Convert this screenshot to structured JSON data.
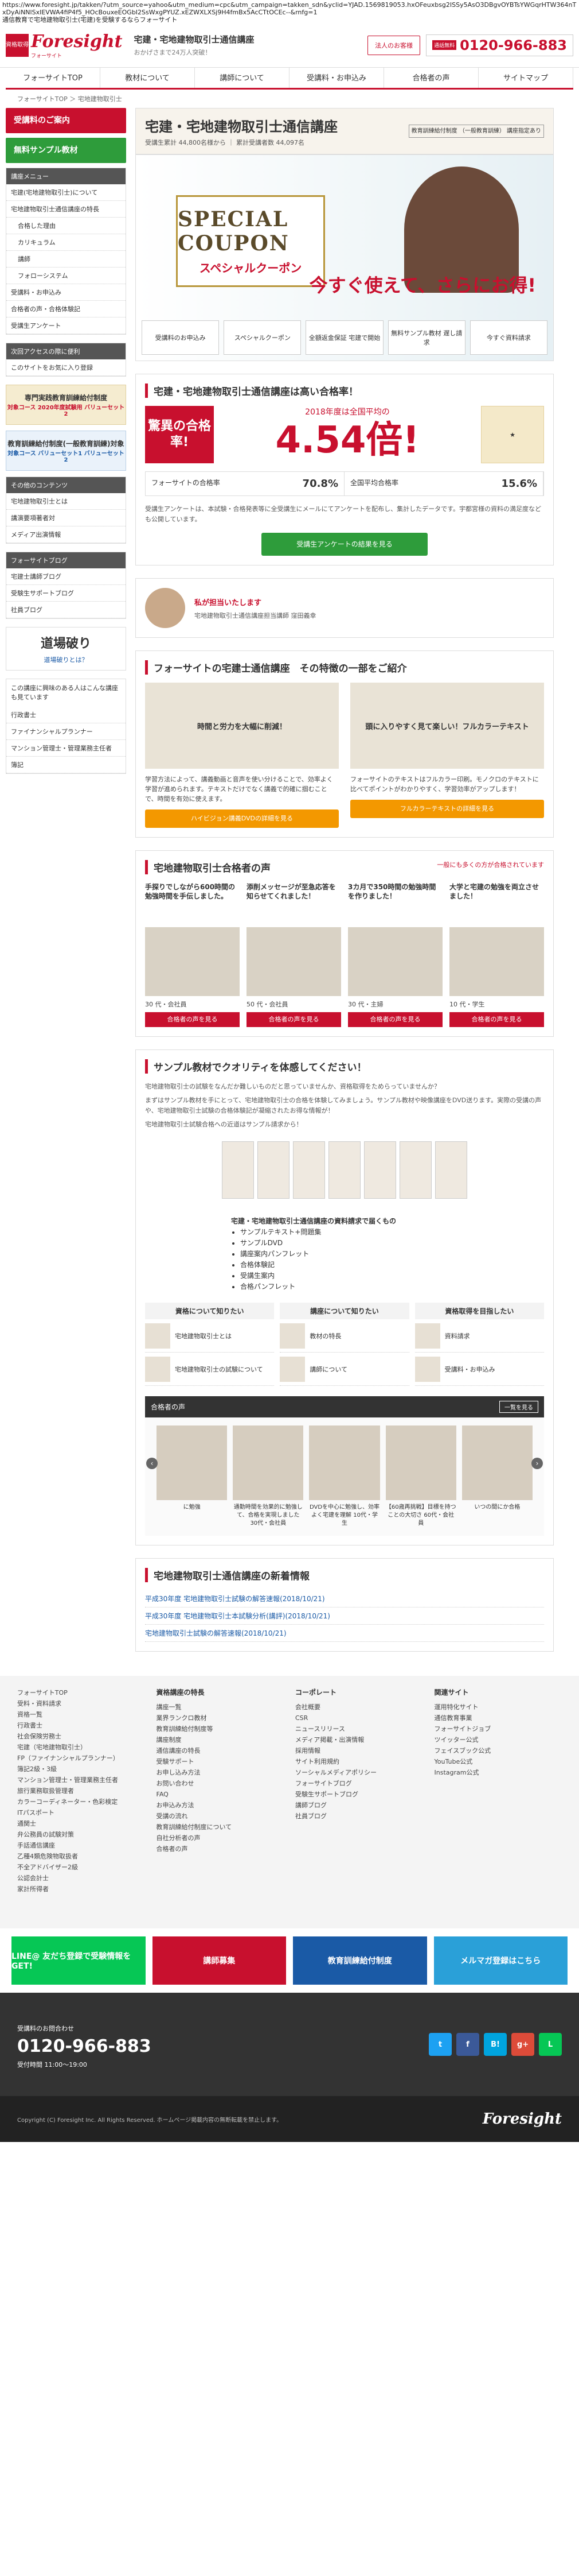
{
  "browser": {
    "url": "https://www.foresight.jp/takken/?utm_source=yahoo&utm_medium=cpc&utm_campaign=takken_sdn&yclid=YJAD.1569819053.hxOFeuxbsg2ISSy5AsO3DBgvOYBTsYWGqrHTW364nTxDyAiNNlSxIEVWA4fiP4f5_HOcBouxeEOGbI2SsWxgPYUZ.xEZWXLXSj9H4fmBx5AcCTtOCEc--&rnfg=1",
    "tab_title": "通信教育で宅地建物取引士(宅建)を受験するならフォーサイト"
  },
  "header": {
    "logo_badge": "資格取得",
    "logo_name": "Foresight",
    "logo_kana": "フォーサイト",
    "title": "宅建・宅地建物取引士通信講座",
    "subtitle": "おかげさまで24万人突破！",
    "corp_button": "法人のお客様",
    "free_badge": "通話無料",
    "tel": "0120-966-883"
  },
  "nav": [
    "フォーサイトTOP",
    "教材について",
    "講師について",
    "受講料・お申込み",
    "合格者の声",
    "サイトマップ"
  ],
  "breadcrumb": "フォーサイトTOP ＞ 宅地建物取引士",
  "sidebar": {
    "apply": "受講料のご案内",
    "sample": "無料サンプル教材",
    "menu_title": "講座メニュー",
    "menu": [
      "宅建(宅地建物取引士)について",
      "宅地建物取引士通信講座の特長",
      "合格した理由",
      "カリキュラム",
      "講師",
      "フォローシステム",
      "受講料・お申込み",
      "合格者の声・合格体験記",
      "受講生アンケート"
    ],
    "sub_idx": [
      2,
      3,
      4,
      5
    ],
    "access_title": "次回アクセスの際に便利",
    "bookmark": "このサイトをお気に入り登録",
    "ban1": "専門実践教育訓練給付制度",
    "ban1_sub": "対象コース 2020年度試験用 バリューセット2",
    "ban2": "教育訓練給付制度(一般教育訓練)対象",
    "ban2_sub": "対象コース バリューセット1 バリューセット2",
    "other_title": "その他のコンテンツ",
    "other": [
      "宅地建物取引士とは",
      "講演要項著者対",
      "メディア出演情報"
    ],
    "blog_title": "フォーサイトブログ",
    "blog": [
      "宅建士講師ブログ",
      "受験生サポートブログ",
      "社員ブログ"
    ],
    "dojo": "道場破り",
    "dojo_link": "道場破りとは？",
    "also_title": "この講座に興味のある人はこんな講座も見ています",
    "also": [
      "行政書士",
      "ファイナンシャルプランナー",
      "マンション管理士・管理業務主任者",
      "簿記"
    ]
  },
  "product": {
    "title": "宅建・宅地建物取引士通信講座",
    "meta": "受講生累計 44,800名様から ｜ 累計受講者数 44,097名",
    "tag": "教育訓練給付制度 （一般教育訓練） 講座指定あり"
  },
  "coupon": {
    "en": "SPECIAL COUPON",
    "kana": "スペシャルクーポン",
    "copy": "今すぐ使えて、さらにお得!",
    "thumbs": [
      "受講料のお申込み",
      "スペシャルクーポン",
      "全額返金保証 宅建で開始",
      "無料サンプル教材 遅し請求",
      "今すぐ資料請求"
    ]
  },
  "rate": {
    "title": "宅建・宅地建物取引士通信講座は高い合格率！",
    "left": "驚異の合格率!",
    "sub": "2018年度は全国平均の",
    "big": "4.54倍!",
    "fs_label": "フォーサイトの合格率",
    "fs_val": "70.8%",
    "nat_label": "全国平均合格率",
    "nat_val": "15.6%",
    "note": "受講生アンケートは、本試験・合格発表等に全受講生にメールにてアンケートを配布し、集計したデータです。宇都宮様の資料の満足度なども公開しています。",
    "btn": "受講生アンケートの結果を見る"
  },
  "profile": {
    "label": "私が担当いたします",
    "name": "宅地建物取引士通信講座担当講師 窪田義幸"
  },
  "features": {
    "title": "フォーサイトの宅建士通信講座　その特徴の一部をご紹介",
    "items": [
      {
        "img": "時間と労力を大幅に削減！",
        "desc": "学習方法によって、講義動画と音声を使い分けることで、効率よく学習が進められます。テキストだけでなく講義で的確に掴むことで、時間を有効に使えます。",
        "btn": "ハイビジョン講義DVDの詳細を見る"
      },
      {
        "img": "頭に入りやすく見て楽しい！フルカラーテキスト",
        "desc": "フォーサイトのテキストはフルカラー印刷。モノクロのテキストに比べてポイントがわかりやすく、学習効率がアップします！",
        "btn": "フルカラーテキストの詳細を見る"
      }
    ]
  },
  "voices": {
    "title": "宅地建物取引士合格者の声",
    "more": "一般にも多くの方が合格されています",
    "items": [
      {
        "q": "手探りでしながら600時間の勉強時間を手伝しました。",
        "who": "30 代・会社員",
        "btn": "合格者の声を見る"
      },
      {
        "q": "添削メッセージが至急応答を知らせてくれました！",
        "who": "50 代・会社員",
        "btn": "合格者の声を見る"
      },
      {
        "q": "3カ月で350時間の勉強時間を作りました！",
        "who": "30 代・主婦",
        "btn": "合格者の声を見る"
      },
      {
        "q": "大学と宅建の勉強を両立させました！",
        "who": "10 代・学生",
        "btn": "合格者の声を見る"
      }
    ]
  },
  "sample": {
    "title": "サンプル教材でクオリティを体感してください！",
    "p1": "宅地建物取引士の試験をなんだか難しいものだと思っていませんか、資格取得をためらっていませんか？",
    "p2": "まずはサンプル教材を手にとって、宅地建物取引士の合格を体験してみましょう。サンプル教材や映像講座をDVD送ります。実際の受講の声や、宅地建物取引士試験の合格体験記が凝縮されたお得な情報が！",
    "p3": "宅地建物取引士試験合格への近道はサンプル請求から！",
    "incl_title": "宅建・宅地建物取引士通信講座の資料請求で届くもの",
    "incl": [
      "サンプルテキスト+問題集",
      "サンプルDVD",
      "講座案内パンフレット",
      "合格体験記",
      "受講生案内",
      "合格パンフレット"
    ],
    "ask": [
      {
        "h": "資格について知りたい",
        "items": [
          "宅地建物取引士とは",
          "宅地建物取引士の試験について"
        ]
      },
      {
        "h": "講座について知りたい",
        "items": [
          "教材の特長",
          "講師について"
        ]
      },
      {
        "h": "資格取得を目指したい",
        "items": [
          "資料請求",
          "受講料・お申込み"
        ]
      }
    ],
    "pass_title": "合格者の声",
    "pass_btn": "一覧を見る",
    "pass": [
      "に勉強",
      "通勤時間を効果的に勉強して、合格を実現しました 30代・会社員",
      "DVDを中心に勉強し、効率よく宅建を理解 10代・学生",
      "【60歳再挑戦】目標を持つことの大切さ 60代・会社員",
      "いつの間にか合格"
    ]
  },
  "news": {
    "title": "宅地建物取引士通信講座の新着情報",
    "items": [
      "平成30年度 宅地建物取引士試験の解答速報(2018/10/21)",
      "平成30年度 宅地建物取引士本試験分析(講評)(2018/10/21)",
      "宅地建物取引士試験の解答速報(2018/10/21)"
    ]
  },
  "footer": {
    "cols": [
      {
        "h": "",
        "items": [
          "フォーサイトTOP",
          "受料・資料請求",
          "",
          "資格一覧",
          "行政書士",
          "社会保険労務士",
          "宅建（宅地建物取引士）",
          "FP（ファイナンシャルプランナー）",
          "簿記2級・3級",
          "マンション管理士・管理業務主任者",
          "旅行業務取扱管理者",
          "カラーコーディネーター・色彩検定",
          "ITパスポート",
          "通関士",
          "弁公務員の試験対策",
          "手話通信講座",
          "乙種4類危険物取扱者",
          "不全アドバイザー2級",
          "公認会計士",
          "家計所得者"
        ]
      },
      {
        "h": "資格講座の特長",
        "items": [
          "講座一覧",
          "業界ランクロ教材",
          "教育訓練給付制度等",
          "講座制度",
          "通信講座の特長",
          "",
          "受験サポート",
          "お申し込み方法",
          "お問い合わせ",
          "FAQ",
          "お申込み方法",
          "受講の流れ",
          "教育訓練給付制度について",
          "自社分析者の声",
          "合格者の声"
        ]
      },
      {
        "h": "コーポレート",
        "items": [
          "会社概要",
          "CSR",
          "ニュースリリース",
          "メディア掲載・出演情報",
          "採用情報",
          "サイト利用規約",
          "ソーシャルメディアポリシー",
          "",
          "フォーサイトブログ",
          "受験生サポートブログ",
          "講師ブログ",
          "社員ブログ"
        ]
      },
      {
        "h": "関連サイト",
        "items": [
          "運用特化サイト",
          "通信教育事業",
          "フォーサイトジョブ",
          "ツイッター公式",
          "フェイスブック公式",
          "YouTube公式",
          "Instagram公式"
        ]
      }
    ],
    "banners": [
      "LINE@ 友だち登録で受験情報をGET!",
      "講師募集",
      "教育訓練給付制度",
      "メルマガ登録はこちら"
    ],
    "tel_label": "受講料のお問合わせ",
    "tel": "0120-966-883",
    "hours": "受付時間 11:00～19:00",
    "social": [
      "t",
      "f",
      "B!",
      "g+",
      "L"
    ],
    "copyright": "Copyright (C) Foresight Inc. All Rights Reserved. ホームページ掲載内容の無断転載を禁止します。",
    "flogo": "Foresight"
  },
  "colors": {
    "brand_red": "#c8102e",
    "green": "#2e9c3b",
    "orange": "#f39800"
  }
}
